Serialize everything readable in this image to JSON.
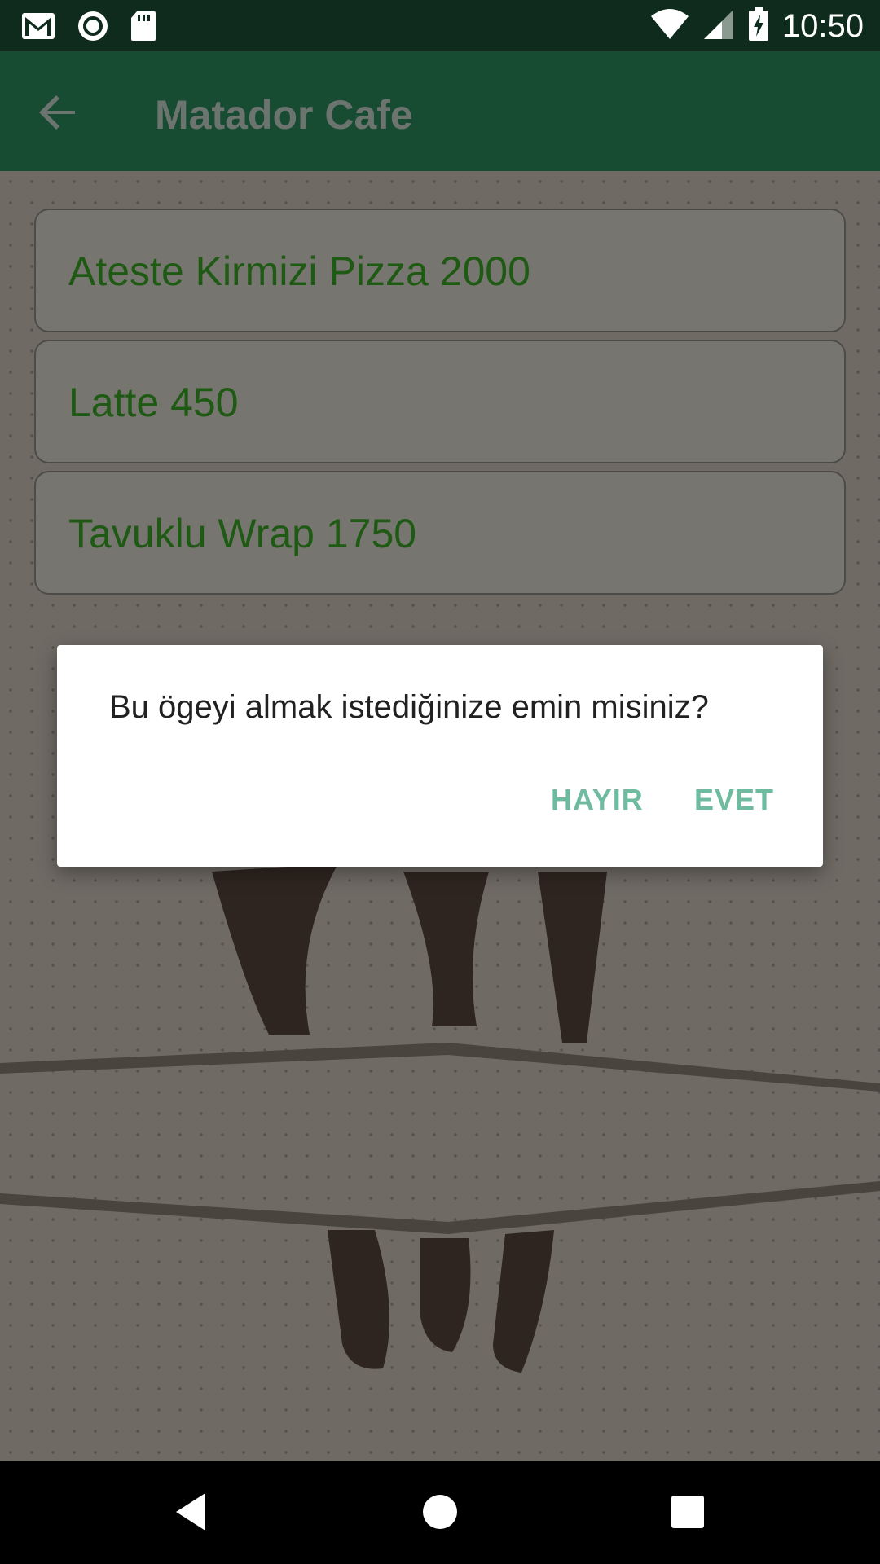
{
  "status_bar": {
    "time": "10:50",
    "left_icons": [
      "gmail-icon",
      "sync-circle-icon",
      "sd-card-icon"
    ],
    "right_icons": [
      "wifi-icon",
      "signal-icon",
      "battery-charging-icon"
    ]
  },
  "app_bar": {
    "title": "Matador Cafe",
    "back_icon": "arrow-back-icon"
  },
  "menu": {
    "items": [
      {
        "label": "Ateste Kirmizi Pizza 2000"
      },
      {
        "label": "Latte 450"
      },
      {
        "label": "Tavuklu Wrap 1750"
      }
    ]
  },
  "dialog": {
    "message": "Bu ögeyi almak istediğinize emin misiniz?",
    "negative_label": "HAYIR",
    "positive_label": "EVET"
  },
  "nav_bar": {
    "icons": [
      "nav-back-icon",
      "nav-home-icon",
      "nav-recents-icon"
    ]
  },
  "colors": {
    "status_bar": "#0e2b1e",
    "app_bar": "#174b32",
    "menu_text": "#1f5a14",
    "dialog_button": "#6fbba0"
  }
}
